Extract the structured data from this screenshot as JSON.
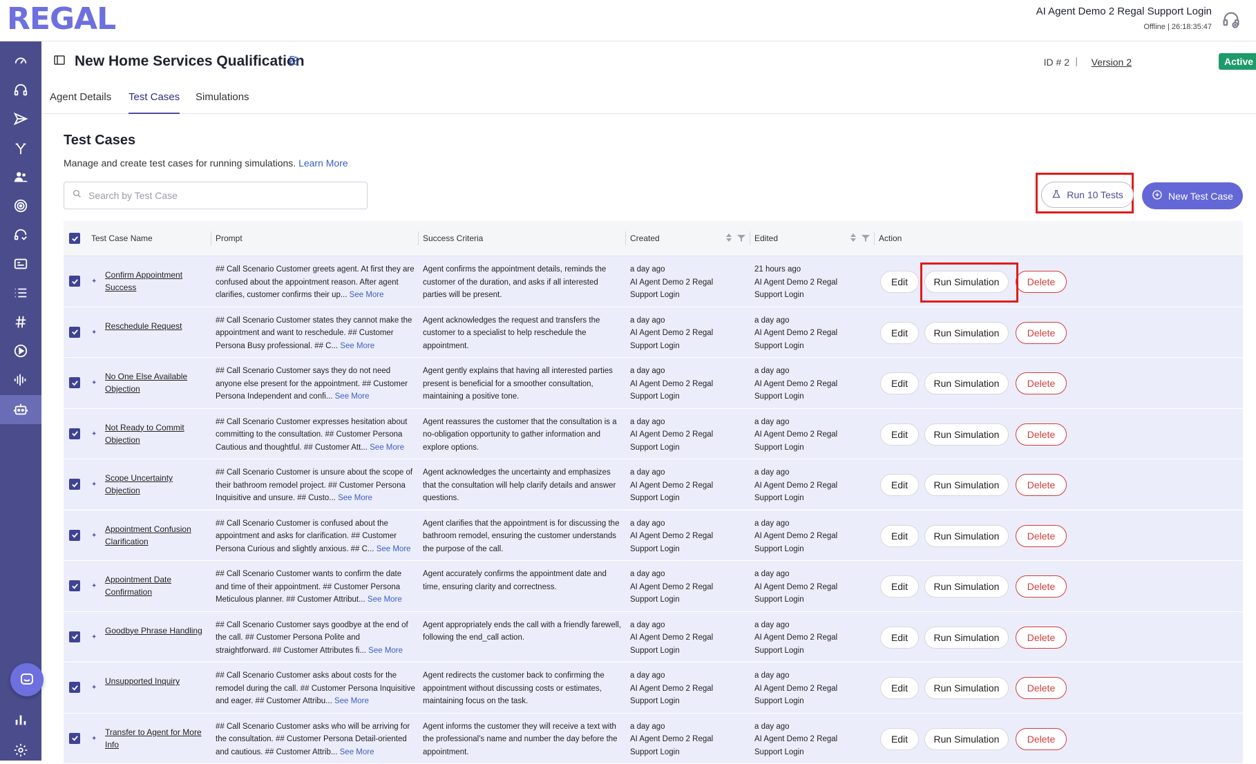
{
  "app": {
    "logo": "REGAL"
  },
  "user": {
    "name": "AI Agent Demo 2 Regal Support Login",
    "status": "Offline  |  26:18:35:47"
  },
  "page": {
    "title": "New Home Services Qualification",
    "id_label": "ID # 2",
    "version": "Version 2",
    "status_badge": "Active"
  },
  "tabs": [
    {
      "label": "Agent Details"
    },
    {
      "label": "Test Cases"
    },
    {
      "label": "Simulations"
    }
  ],
  "section": {
    "title": "Test Cases",
    "description": "Manage and create test cases for running simulations.",
    "learn_more": "Learn More"
  },
  "search": {
    "placeholder": "Search by Test Case"
  },
  "toolbar": {
    "run_tests": "Run 10 Tests",
    "new_test_case": "New Test Case"
  },
  "table": {
    "headers": {
      "name": "Test Case Name",
      "prompt": "Prompt",
      "criteria": "Success Criteria",
      "created": "Created",
      "edited": "Edited",
      "action": "Action"
    },
    "action_labels": {
      "edit": "Edit",
      "run": "Run Simulation",
      "delete": "Delete"
    },
    "see_more": "See More",
    "rows": [
      {
        "name": "Confirm Appointment Success",
        "prompt": "## Call Scenario Customer greets agent. At first they are confused about the appointment reason. After agent clarifies, customer confirms their up...",
        "criteria": "Agent confirms the appointment details, reminds the customer of the duration, and asks if all interested parties will be present.",
        "created_time": "a day ago",
        "created_by": "AI Agent Demo 2 Regal Support Login",
        "edited_time": "21 hours ago",
        "edited_by": "AI Agent Demo 2 Regal Support Login"
      },
      {
        "name": "Reschedule Request",
        "prompt": "## Call Scenario Customer states they cannot make the appointment and want to reschedule. ## Customer Persona Busy professional. ## C...",
        "criteria": "Agent acknowledges the request and transfers the customer to a specialist to help reschedule the appointment.",
        "created_time": "a day ago",
        "created_by": "AI Agent Demo 2 Regal Support Login",
        "edited_time": "a day ago",
        "edited_by": "AI Agent Demo 2 Regal Support Login"
      },
      {
        "name": "No One Else Available Objection",
        "prompt": "## Call Scenario Customer says they do not need anyone else present for the appointment. ## Customer Persona Independent and confi...",
        "criteria": "Agent gently explains that having all interested parties present is beneficial for a smoother consultation, maintaining a positive tone.",
        "created_time": "a day ago",
        "created_by": "AI Agent Demo 2 Regal Support Login",
        "edited_time": "a day ago",
        "edited_by": "AI Agent Demo 2 Regal Support Login"
      },
      {
        "name": "Not Ready to Commit Objection",
        "prompt": "## Call Scenario Customer expresses hesitation about committing to the consultation. ## Customer Persona Cautious and thoughtful. ## Customer Att...",
        "criteria": "Agent reassures the customer that the consultation is a no-obligation opportunity to gather information and explore options.",
        "created_time": "a day ago",
        "created_by": "AI Agent Demo 2 Regal Support Login",
        "edited_time": "a day ago",
        "edited_by": "AI Agent Demo 2 Regal Support Login"
      },
      {
        "name": "Scope Uncertainty Objection",
        "prompt": "## Call Scenario Customer is unsure about the scope of their bathroom remodel project. ## Customer Persona Inquisitive and unsure. ## Custo...",
        "criteria": "Agent acknowledges the uncertainty and emphasizes that the consultation will help clarify details and answer questions.",
        "created_time": "a day ago",
        "created_by": "AI Agent Demo 2 Regal Support Login",
        "edited_time": "a day ago",
        "edited_by": "AI Agent Demo 2 Regal Support Login"
      },
      {
        "name": "Appointment Confusion Clarification",
        "prompt": "## Call Scenario Customer is confused about the appointment and asks for clarification. ## Customer Persona Curious and slightly anxious. ## C...",
        "criteria": "Agent clarifies that the appointment is for discussing the bathroom remodel, ensuring the customer understands the purpose of the call.",
        "created_time": "a day ago",
        "created_by": "AI Agent Demo 2 Regal Support Login",
        "edited_time": "a day ago",
        "edited_by": "AI Agent Demo 2 Regal Support Login"
      },
      {
        "name": "Appointment Date Confirmation",
        "prompt": "## Call Scenario Customer wants to confirm the date and time of their appointment. ## Customer Persona Meticulous planner. ## Customer Attribut...",
        "criteria": "Agent accurately confirms the appointment date and time, ensuring clarity and correctness.",
        "created_time": "a day ago",
        "created_by": "AI Agent Demo 2 Regal Support Login",
        "edited_time": "a day ago",
        "edited_by": "AI Agent Demo 2 Regal Support Login"
      },
      {
        "name": "Goodbye Phrase Handling",
        "prompt": "## Call Scenario Customer says goodbye at the end of the call. ## Customer Persona Polite and straightforward. ## Customer Attributes fi...",
        "criteria": "Agent appropriately ends the call with a friendly farewell, following the end_call action.",
        "created_time": "a day ago",
        "created_by": "AI Agent Demo 2 Regal Support Login",
        "edited_time": "a day ago",
        "edited_by": "AI Agent Demo 2 Regal Support Login"
      },
      {
        "name": "Unsupported Inquiry",
        "prompt": "## Call Scenario Customer asks about costs for the remodel during the call. ## Customer Persona Inquisitive and eager. ## Customer Attribu...",
        "criteria": "Agent redirects the customer back to confirming the appointment without discussing costs or estimates, maintaining focus on the task.",
        "created_time": "a day ago",
        "created_by": "AI Agent Demo 2 Regal Support Login",
        "edited_time": "a day ago",
        "edited_by": "AI Agent Demo 2 Regal Support Login"
      },
      {
        "name": "Transfer to Agent for More Info",
        "prompt": "## Call Scenario Customer asks who will be arriving for the consultation. ## Customer Persona Detail-oriented and cautious. ## Customer Attrib...",
        "criteria": "Agent informs the customer they will receive a text with the professional's name and number the day before the appointment.",
        "created_time": "a day ago",
        "created_by": "AI Agent Demo 2 Regal Support Login",
        "edited_time": "a day ago",
        "edited_by": "AI Agent Demo 2 Regal Support Login"
      }
    ]
  },
  "colors": {
    "sidebar": "#4a4c8c",
    "accent": "#6467d6",
    "active_badge": "#1e9b6a",
    "delete": "#d43b3b",
    "highlight": "#e01b1b"
  },
  "icons": {
    "sidebar": [
      "dashboard-icon",
      "headset-icon",
      "send-icon",
      "branch-icon",
      "users-icon",
      "target-icon",
      "phone-support-icon",
      "card-icon",
      "list-icon",
      "hash-icon",
      "play-icon",
      "waveform-icon",
      "robot-icon",
      "bar-chart-icon",
      "gear-icon"
    ]
  }
}
